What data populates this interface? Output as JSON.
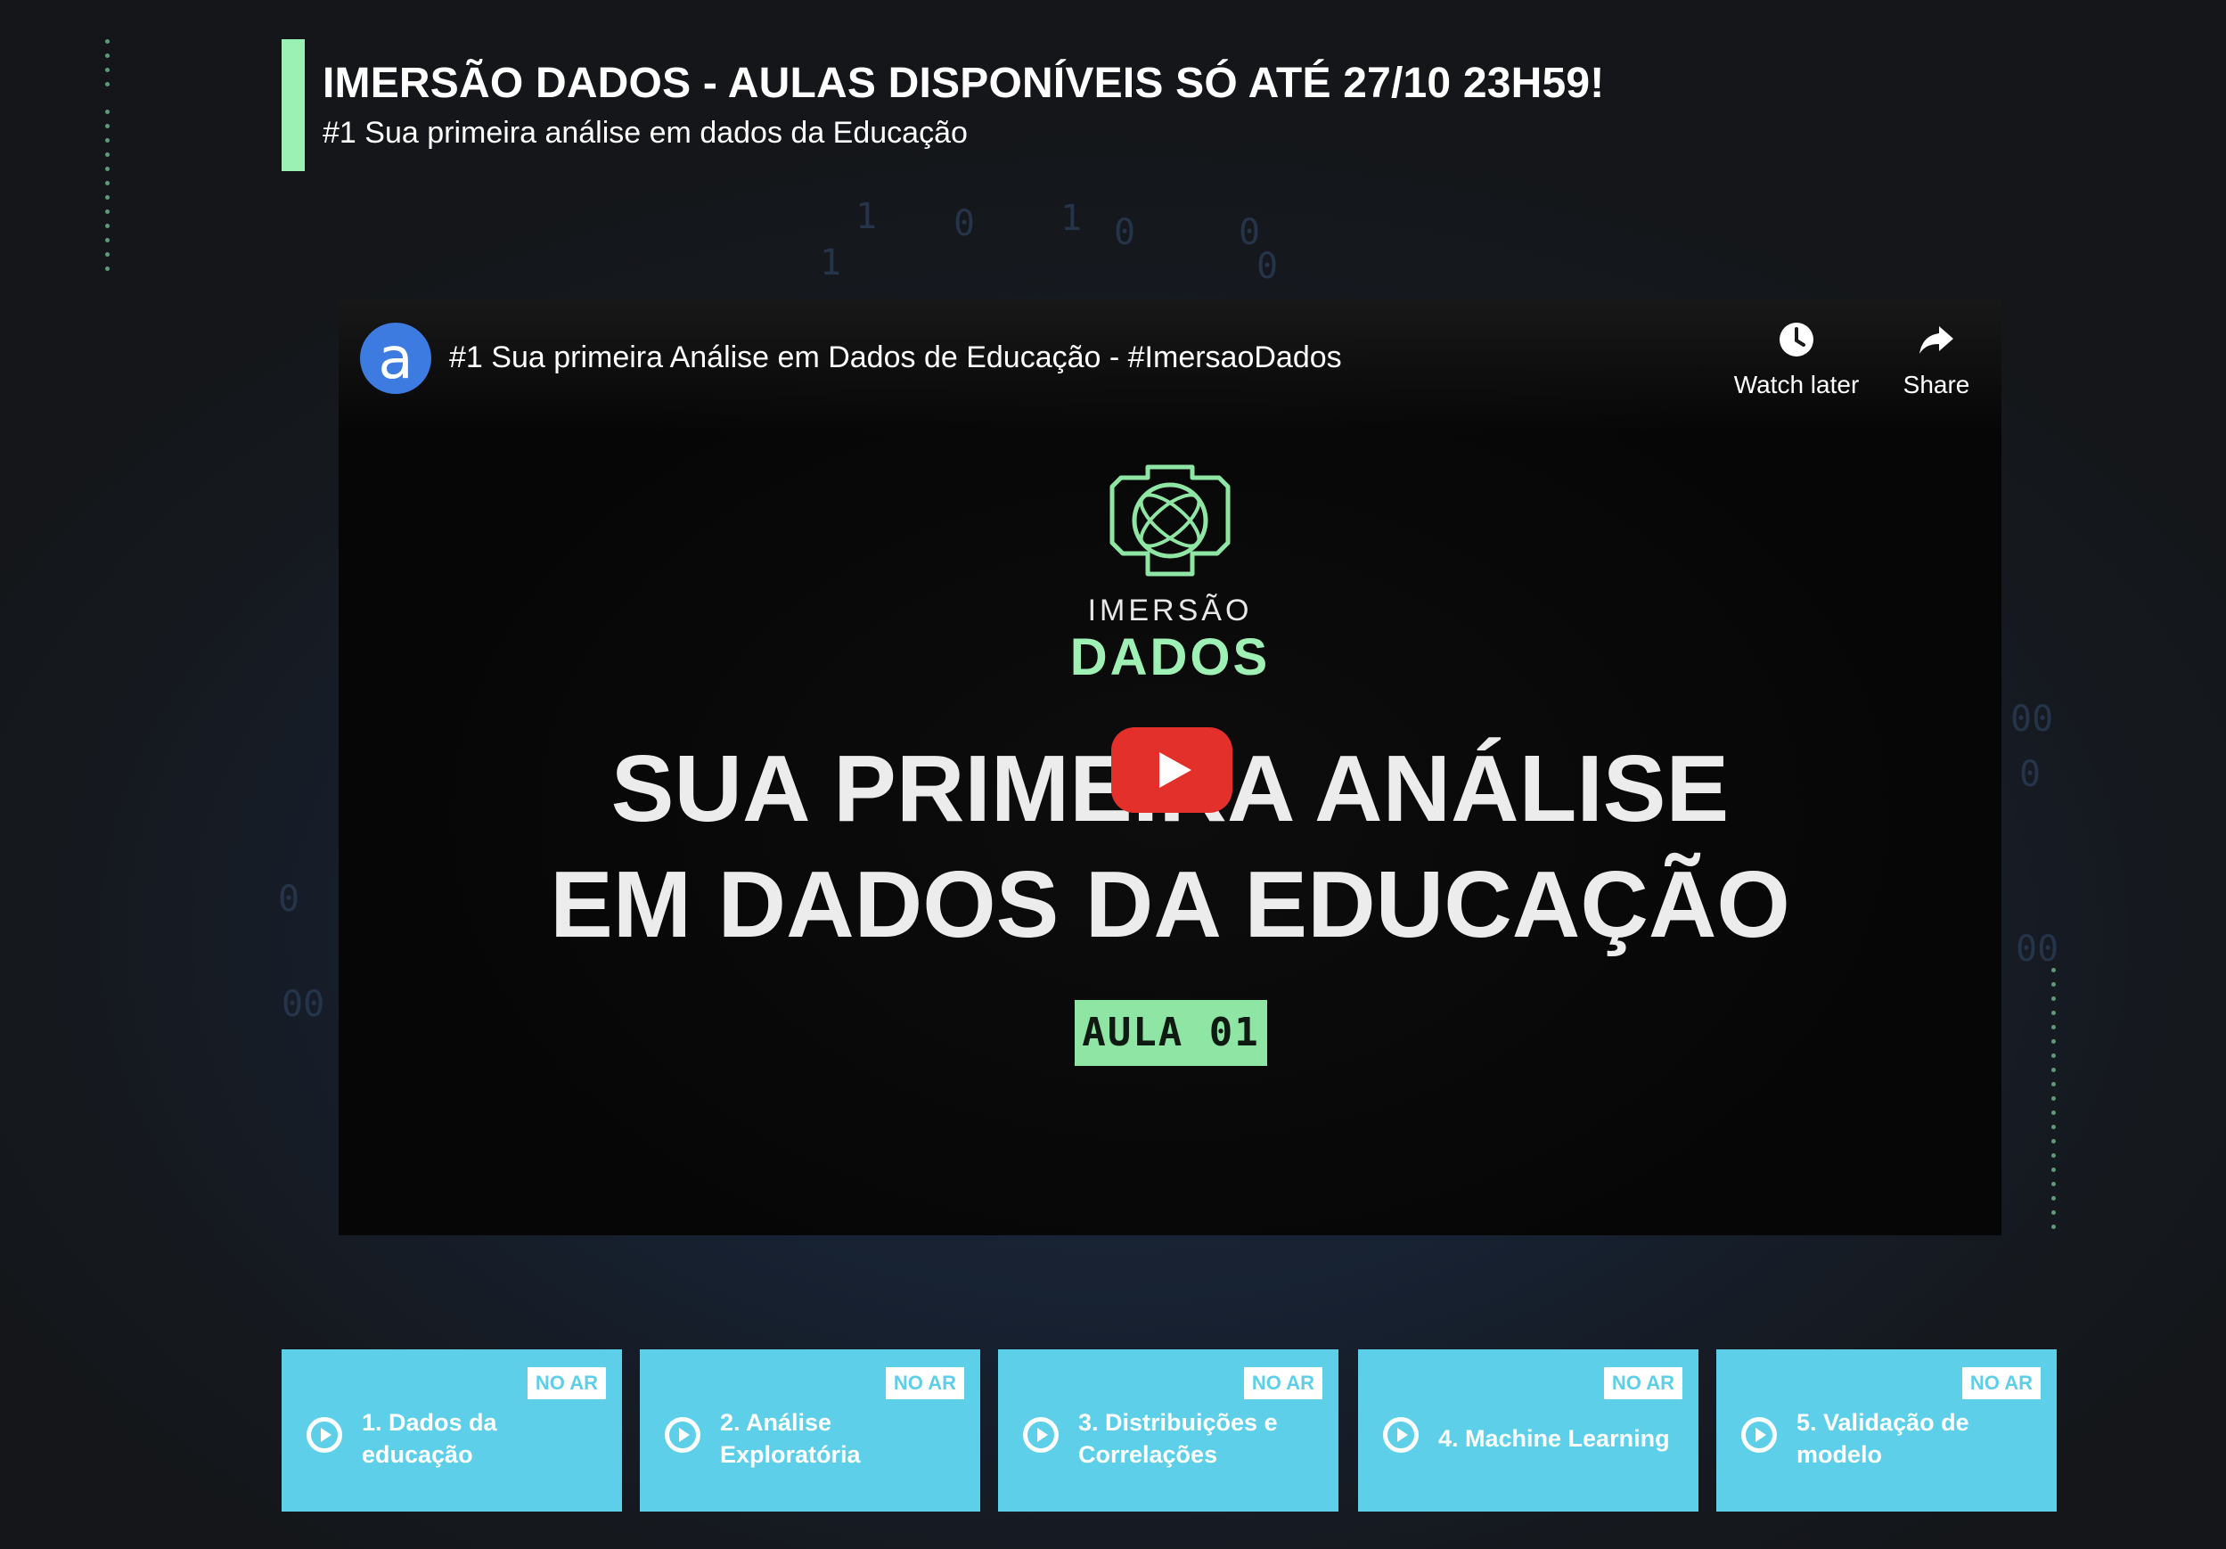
{
  "header": {
    "title": "IMERSÃO DADOS - AULAS DISPONÍVEIS SÓ ATÉ 27/10 23H59!",
    "subtitle": "#1 Sua primeira análise em dados da Educação",
    "accent_color": "#9af1b3"
  },
  "video": {
    "channel_avatar_letter": "a",
    "title": "#1 Sua primeira Análise em Dados de Educação - #ImersaoDados",
    "actions": {
      "watch_later": "Watch later",
      "share": "Share"
    },
    "thumbnail": {
      "brand_top": "IMERSÃO",
      "brand_bottom": "DADOS",
      "headline_line1": "SUA PRIMEIRA ANÁLISE",
      "headline_line2": "EM DADOS DA EDUCAÇÃO",
      "badge": "AULA 01"
    },
    "play_button_color": "#e3302a"
  },
  "lessons": [
    {
      "badge": "NO AR",
      "label": "1. Dados da educação"
    },
    {
      "badge": "NO AR",
      "label": "2. Análise Exploratória"
    },
    {
      "badge": "NO AR",
      "label": "3. Distribuições e Correlações"
    },
    {
      "badge": "NO AR",
      "label": "4. Machine Learning"
    },
    {
      "badge": "NO AR",
      "label": "5. Validação de modelo"
    }
  ],
  "lesson_card_color": "#5ecfe8"
}
